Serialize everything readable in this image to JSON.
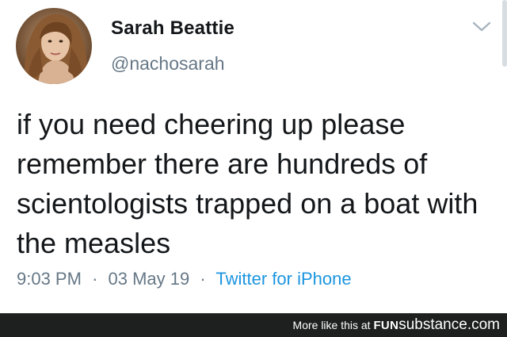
{
  "tweet": {
    "display_name": "Sarah Beattie",
    "handle": "@nachosarah",
    "text": "if you need cheering up please\nremember there are hundreds of\nscientologists trapped on a boat with\nthe measles",
    "time": "9:03 PM",
    "separator": "·",
    "date": "03 May 19",
    "source": "Twitter for iPhone",
    "avatar_icon": "profile-photo",
    "menu_icon": "chevron-down-icon"
  },
  "footer": {
    "more_text": "More like this at",
    "brand_fun": "FUN",
    "brand_rest": "substance.com"
  },
  "colors": {
    "link": "#1b95e0",
    "secondary_text": "#657786",
    "primary_text": "#14171a",
    "footer_bg": "#1e1f1f"
  }
}
